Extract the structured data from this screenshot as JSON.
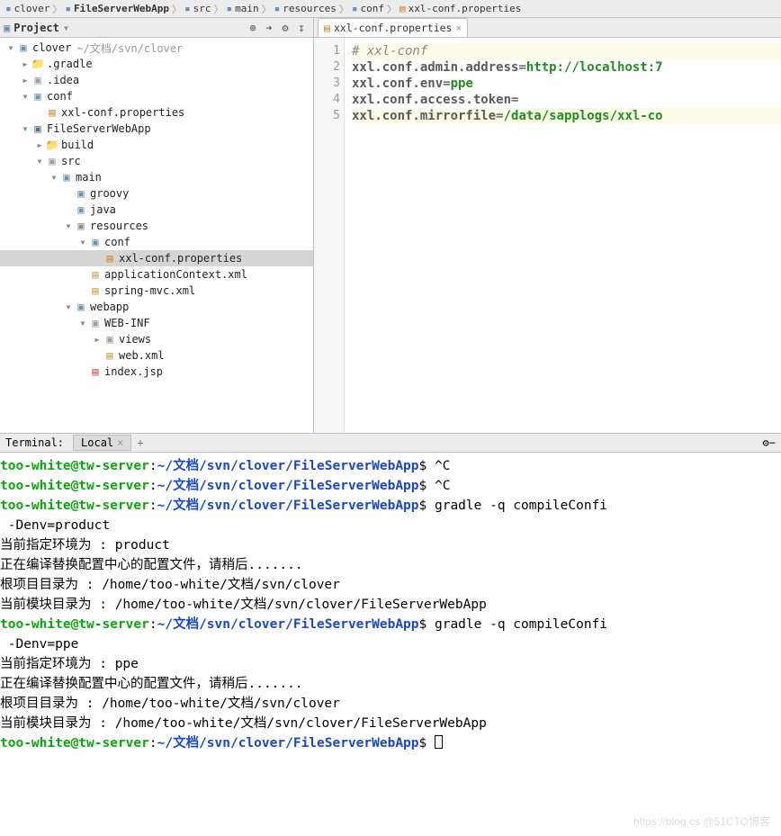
{
  "breadcrumb": [
    "clover",
    "FileServerWebApp",
    "src",
    "main",
    "resources",
    "conf",
    "xxl-conf.properties"
  ],
  "projectPanel": {
    "title": "Project"
  },
  "editor": {
    "tab": "xxl-conf.properties",
    "gutter": [
      "1",
      "2",
      "3",
      "4",
      "5"
    ],
    "lines": [
      {
        "type": "comment",
        "text": "# xxl-conf",
        "hl": true
      },
      {
        "type": "kv",
        "key": "xxl.conf.admin.address",
        "val": "http://localhost:7"
      },
      {
        "type": "kv",
        "key": "xxl.conf.env",
        "val": "ppe"
      },
      {
        "type": "kv",
        "key": "xxl.conf.access.token",
        "val": ""
      },
      {
        "type": "kv",
        "key": "xxl.conf.mirrorfile",
        "val": "/data/sapplogs/xxl-co",
        "hl": true
      }
    ]
  },
  "tree": [
    {
      "d": 0,
      "arrow": "down",
      "icon": "folder-blue",
      "label": "clover",
      "path": "~/文档/svn/clover"
    },
    {
      "d": 1,
      "arrow": "right",
      "icon": "folder-orange",
      "label": ".gradle"
    },
    {
      "d": 1,
      "arrow": "right",
      "icon": "folder-gray",
      "label": ".idea"
    },
    {
      "d": 1,
      "arrow": "down",
      "icon": "folder-blue",
      "label": "conf"
    },
    {
      "d": 2,
      "arrow": "none",
      "icon": "file-prop",
      "label": "xxl-conf.properties"
    },
    {
      "d": 1,
      "arrow": "down",
      "icon": "folder-blue-dk",
      "label": "FileServerWebApp"
    },
    {
      "d": 2,
      "arrow": "right",
      "icon": "folder-orange",
      "label": "build"
    },
    {
      "d": 2,
      "arrow": "down",
      "icon": "folder-gray",
      "label": "src"
    },
    {
      "d": 3,
      "arrow": "down",
      "icon": "folder-blue",
      "label": "main"
    },
    {
      "d": 4,
      "arrow": "none",
      "icon": "folder-blue",
      "label": "groovy"
    },
    {
      "d": 4,
      "arrow": "none",
      "icon": "folder-blue",
      "label": "java"
    },
    {
      "d": 4,
      "arrow": "down",
      "icon": "folder-res",
      "label": "resources"
    },
    {
      "d": 5,
      "arrow": "down",
      "icon": "folder-blue",
      "label": "conf"
    },
    {
      "d": 6,
      "arrow": "none",
      "icon": "file-prop",
      "label": "xxl-conf.properties",
      "selected": true
    },
    {
      "d": 5,
      "arrow": "none",
      "icon": "file-xml",
      "label": "applicationContext.xml"
    },
    {
      "d": 5,
      "arrow": "none",
      "icon": "file-xml",
      "label": "spring-mvc.xml"
    },
    {
      "d": 4,
      "arrow": "down",
      "icon": "folder-blue",
      "label": "webapp"
    },
    {
      "d": 5,
      "arrow": "down",
      "icon": "folder-gray",
      "label": "WEB-INF"
    },
    {
      "d": 6,
      "arrow": "right",
      "icon": "folder-gray",
      "label": "views"
    },
    {
      "d": 6,
      "arrow": "none",
      "icon": "file-xml",
      "label": "web.xml"
    },
    {
      "d": 5,
      "arrow": "none",
      "icon": "file-jsp",
      "label": "index.jsp"
    }
  ],
  "terminalPanel": {
    "title": "Terminal:",
    "tab": "Local"
  },
  "terminal": {
    "prompt": {
      "user": "too-white@tw-server",
      "sep": ":",
      "tilde": "~/文档",
      "path": "/svn/clover/FileServerWebApp",
      "end": "$ "
    },
    "lines": [
      {
        "t": "p",
        "cmd": "^C"
      },
      {
        "t": "p",
        "cmd": "^C"
      },
      {
        "t": "p",
        "cmd": "gradle -q compileConfi"
      },
      {
        "t": "o",
        "text": " -Denv=product"
      },
      {
        "t": "o",
        "text": "当前指定环境为 : product"
      },
      {
        "t": "o",
        "text": "正在编译替换配置中心的配置文件，请稍后......."
      },
      {
        "t": "o",
        "text": "根项目目录为 : /home/too-white/文档/svn/clover"
      },
      {
        "t": "o",
        "text": "当前模块目录为 : /home/too-white/文档/svn/clover/FileServerWebApp"
      },
      {
        "t": "p",
        "cmd": "gradle -q compileConfi"
      },
      {
        "t": "o",
        "text": " -Denv=ppe"
      },
      {
        "t": "o",
        "text": "当前指定环境为 : ppe"
      },
      {
        "t": "o",
        "text": "正在编译替换配置中心的配置文件，请稍后......."
      },
      {
        "t": "o",
        "text": "根项目目录为 : /home/too-white/文档/svn/clover"
      },
      {
        "t": "o",
        "text": "当前模块目录为 : /home/too-white/文档/svn/clover/FileServerWebApp"
      },
      {
        "t": "p",
        "cmd": "",
        "cursor": true
      }
    ]
  },
  "watermark": "https://blog.cs @51CTO博客"
}
